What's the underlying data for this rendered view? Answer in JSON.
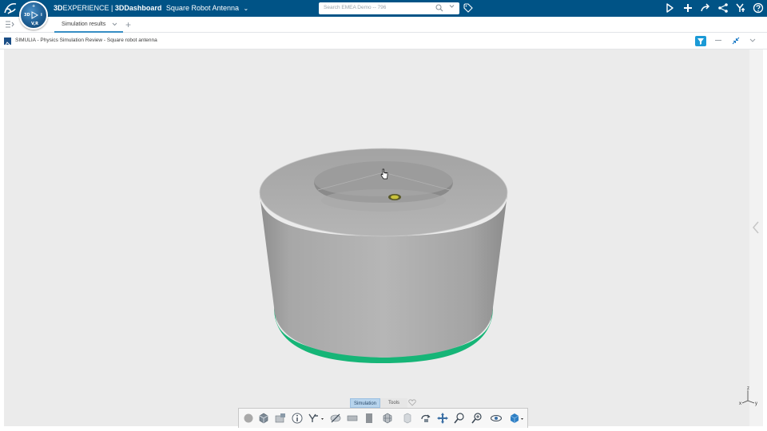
{
  "topbar": {
    "brand_prefix": "3D",
    "brand_experience": "EXPERIENCE",
    "brand_sep": " | ",
    "brand_app": "3DDashboard",
    "dashboard_name": "Square Robot Antenna",
    "compass_quadrants": [
      "3D",
      "V,R",
      "i",
      "+"
    ],
    "search_placeholder": "Search EMEA Demo -- 796",
    "icons": [
      "tag-icon",
      "share-arrow-icon",
      "plus-icon",
      "forward-icon",
      "network-share-icon",
      "apps-icon",
      "help-icon"
    ]
  },
  "tabbar": {
    "tabs": [
      {
        "label": "Simulation results",
        "active": true
      }
    ],
    "add_tab": "+"
  },
  "app": {
    "title": "SIMULIA - Physics Simulation Review - Square robot antenna"
  },
  "viewport": {
    "background_color": "#ebebeb",
    "model_color": "#a9a9a9",
    "base_ring_color": "#16b577",
    "triad": {
      "z": "z",
      "x": "x",
      "y": "y"
    }
  },
  "bottom": {
    "tabs": [
      {
        "label": "Simulation",
        "active": true
      },
      {
        "label": "Tools",
        "active": false
      }
    ],
    "toolbar_icons": [
      "record-icon",
      "view-cube-icon",
      "capture-icon",
      "info-icon",
      "plot-icon",
      "hide-icon",
      "plane-icon",
      "section-icon",
      "mesh-icon",
      "material-icon",
      "rotate-icon",
      "pan-icon",
      "zoom-box-icon",
      "zoom-icon",
      "look-at-icon",
      "render-style-icon"
    ]
  },
  "colors": {
    "topbar": "#005386",
    "accent": "#368ec4",
    "filter_button": "#1b9ad6"
  }
}
